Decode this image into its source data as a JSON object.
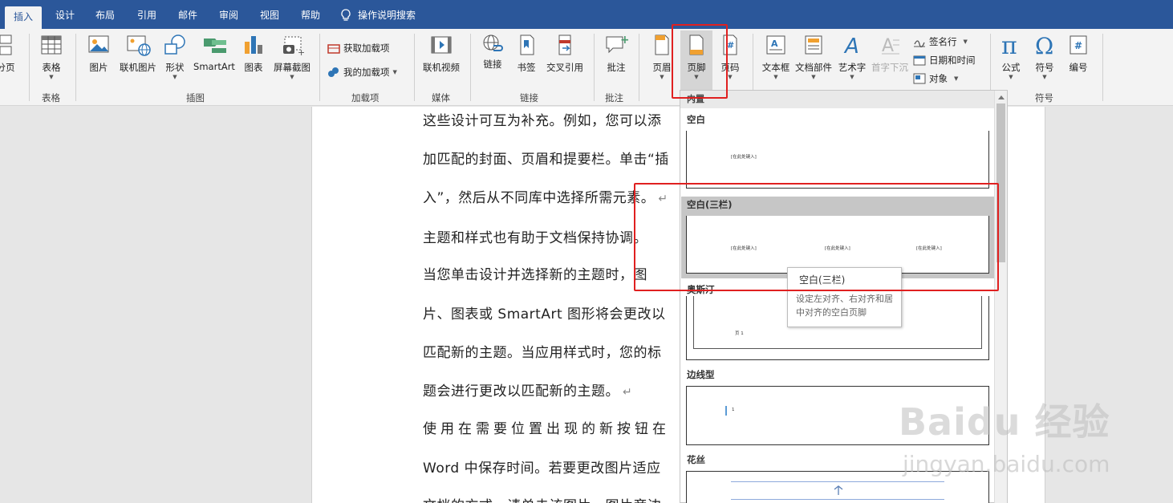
{
  "tabs": [
    {
      "label": "插入"
    },
    {
      "label": "设计"
    },
    {
      "label": "布局"
    },
    {
      "label": "引用"
    },
    {
      "label": "邮件"
    },
    {
      "label": "审阅"
    },
    {
      "label": "视图"
    },
    {
      "label": "帮助"
    }
  ],
  "tell_me": "操作说明搜索",
  "ribbon": {
    "page_break": "分页",
    "table": "表格",
    "picture": "图片",
    "online_picture": "联机图片",
    "shapes": "形状",
    "smartart": "SmartArt",
    "chart": "图表",
    "screenshot": "屏幕截图",
    "get_addins": "获取加载项",
    "my_addins": "我的加载项",
    "online_video": "联机视频",
    "link": "链接",
    "bookmark": "书签",
    "cross_ref": "交叉引用",
    "comment": "批注",
    "header": "页眉",
    "footer": "页脚",
    "page_number": "页码",
    "textbox": "文本框",
    "quick_parts": "文档部件",
    "wordart": "艺术字",
    "dropcap": "首字下沉",
    "signature": "签名行",
    "datetime": "日期和时间",
    "object": "对象",
    "equation": "公式",
    "symbol": "符号",
    "numbering": "编号",
    "groups": {
      "tables": "表格",
      "illustrations": "插图",
      "addins": "加载项",
      "media": "媒体",
      "links": "链接",
      "comments": "批注",
      "symbols": "符号"
    }
  },
  "document_lines": [
    "这些设计可互为补充。例如，您可以添",
    "加匹配的封面、页眉和提要栏。单击“插",
    "入”，然后从不同库中选择所需元素。",
    "主题和样式也有助于文档保持协调。",
    "当您单击设计并选择新的主题时，图",
    "片、图表或 SmartArt 图形将会更改以",
    "匹配新的主题。当应用样式时，您的标",
    "题会进行更改以匹配新的主题。",
    "使用在需要位置出现的新按钮在",
    "Word 中保存时间。若要更改图片适应",
    "文档的方式，请单击该图片，图片旁边"
  ],
  "gallery": {
    "section": "内置",
    "items": [
      {
        "name": "空白",
        "placeholder": "[在此处键入]"
      },
      {
        "name": "空白(三栏)",
        "placeholder": "[在此处键入]"
      },
      {
        "name": "奥斯汀",
        "placeholder": "页 1"
      },
      {
        "name": "边线型",
        "placeholder": "1"
      },
      {
        "name": "花丝",
        "placeholder": ""
      }
    ]
  },
  "tooltip": {
    "title": "空白(三栏)",
    "description": "设定左对齐、右对齐和居中对齐的空白页脚"
  },
  "watermark": {
    "brand": "Baidu 经验",
    "url": "jingyan.baidu.com"
  }
}
